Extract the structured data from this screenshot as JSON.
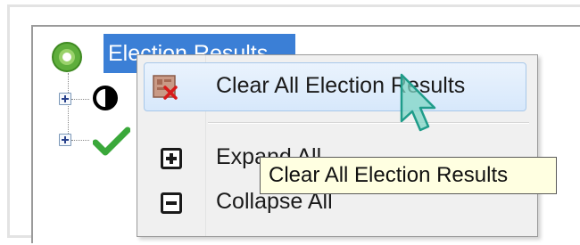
{
  "tree": {
    "root_label": "Election Results",
    "root_icon": "election-results-icon",
    "children": [
      {
        "icon": "contrast-icon"
      },
      {
        "icon": "checkmark-icon"
      }
    ]
  },
  "context_menu": {
    "items": [
      {
        "label": "Clear All Election Results",
        "icon": "clear-results-icon",
        "highlighted": true
      },
      {
        "label": "Expand All",
        "icon": "expand-all-icon"
      },
      {
        "label": "Collapse All",
        "icon": "collapse-all-icon"
      }
    ]
  },
  "tooltip": {
    "text": "Clear All Election Results"
  },
  "colors": {
    "selection": "#3b7fd6",
    "highlight_border": "#a8c8ea",
    "tooltip_bg": "#ffffe1",
    "check_green": "#3aa83a"
  }
}
